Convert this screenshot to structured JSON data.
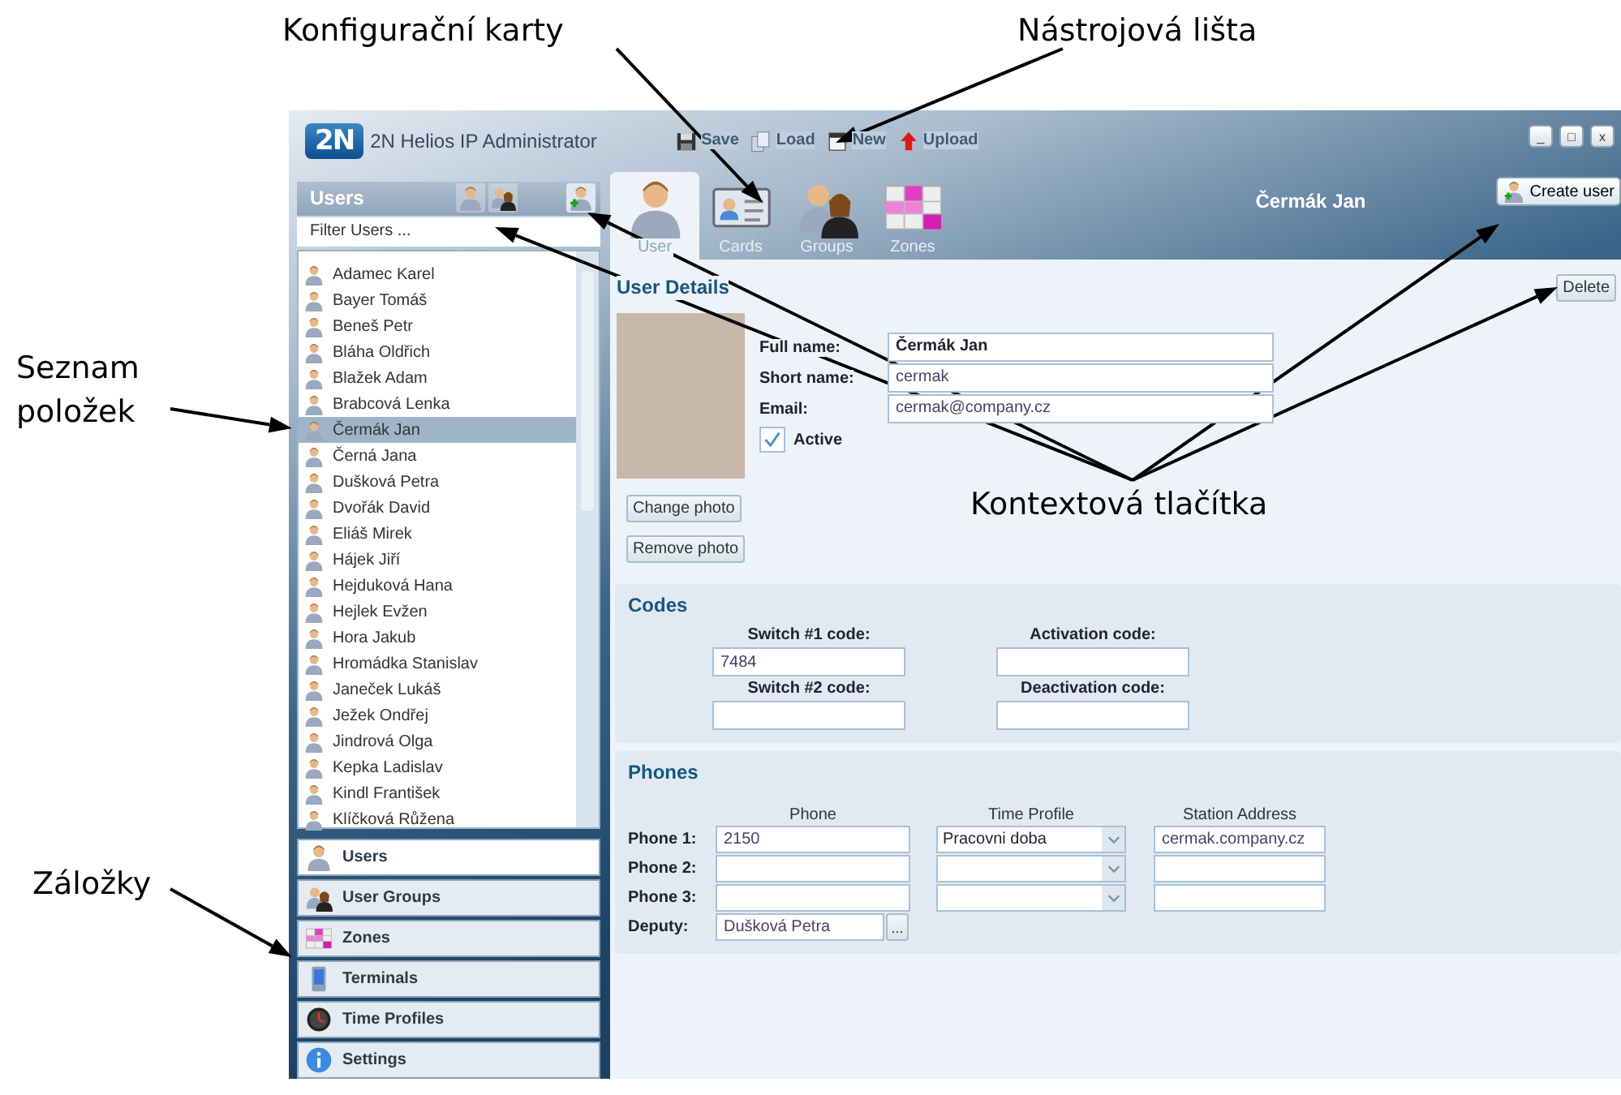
{
  "annotations": [
    {
      "text": "Konfigurační karty",
      "kind": "top"
    },
    {
      "text": "Nástrojová lišta",
      "kind": "top"
    },
    {
      "text": "Seznam položek",
      "kind": "side"
    },
    {
      "text": "Kontextová tlačítka",
      "kind": "middle"
    },
    {
      "text": "Záložky",
      "kind": "side"
    }
  ],
  "window": {
    "logo": "2N",
    "title": "2N Helios IP Administrator",
    "toolbar": [
      {
        "label": "Save",
        "kind": "save"
      },
      {
        "label": "Load",
        "kind": "load"
      },
      {
        "label": "New",
        "kind": "new"
      },
      {
        "label": "Upload",
        "kind": "upload"
      }
    ],
    "controls": [
      "_",
      "□",
      "x"
    ]
  },
  "sidebar": {
    "title": "Users",
    "filter": {
      "placeholder": "Filter Users ..."
    },
    "items": [
      {
        "label": "Adamec Karel",
        "selected": false
      },
      {
        "label": "Bayer Tomáš",
        "selected": false
      },
      {
        "label": "Beneš Petr",
        "selected": false
      },
      {
        "label": "Bláha Oldřich",
        "selected": false
      },
      {
        "label": "Blažek Adam",
        "selected": false
      },
      {
        "label": "Brabcová Lenka",
        "selected": false
      },
      {
        "label": "Čermák Jan",
        "selected": true
      },
      {
        "label": "Černá Jana",
        "selected": false
      },
      {
        "label": "Dušková Petra",
        "selected": false
      },
      {
        "label": "Dvořák David",
        "selected": false
      },
      {
        "label": "Eliáš Mirek",
        "selected": false
      },
      {
        "label": "Hájek Jiří",
        "selected": false
      },
      {
        "label": "Hejduková Hana",
        "selected": false
      },
      {
        "label": "Hejlek Evžen",
        "selected": false
      },
      {
        "label": "Hora Jakub",
        "selected": false
      },
      {
        "label": "Hromádka Stanislav",
        "selected": false
      },
      {
        "label": "Janeček Lukáš",
        "selected": false
      },
      {
        "label": "Ježek Ondřej",
        "selected": false
      },
      {
        "label": "Jindrová Olga",
        "selected": false
      },
      {
        "label": "Kepka Ladislav",
        "selected": false
      },
      {
        "label": "Kindl František",
        "selected": false
      },
      {
        "label": "Klíčková Růžena",
        "selected": false
      }
    ],
    "nav": [
      {
        "label": "Users",
        "kind": "user",
        "selected": true
      },
      {
        "label": "User Groups",
        "kind": "group",
        "selected": false
      },
      {
        "label": "Zones",
        "kind": "zones",
        "selected": false
      },
      {
        "label": "Terminals",
        "kind": "terminal",
        "selected": false
      },
      {
        "label": "Time Profiles",
        "kind": "clock",
        "selected": false
      },
      {
        "label": "Settings",
        "kind": "info",
        "selected": false
      }
    ]
  },
  "config_tabs": [
    {
      "label": "User",
      "kind": "user",
      "selected": true
    },
    {
      "label": "Cards",
      "kind": "card",
      "selected": false
    },
    {
      "label": "Groups",
      "kind": "group",
      "selected": false
    },
    {
      "label": "Zones",
      "kind": "zones",
      "selected": false
    }
  ],
  "header_name": "Čermák Jan",
  "create_button": "Create user",
  "user_details": {
    "title": "User Details",
    "delete_button": "Delete",
    "fields": [
      {
        "label": "Full name:",
        "value": "Čermák Jan",
        "bold": true
      },
      {
        "label": "Short name:",
        "value": "cermak",
        "bold": false
      },
      {
        "label": "Email:",
        "value": "cermak@company.cz",
        "bold": false
      }
    ],
    "active": {
      "label": "Active",
      "checked": true
    },
    "buttons": [
      "Change photo",
      "Remove photo"
    ]
  },
  "codes": {
    "title": "Codes",
    "fields": [
      {
        "label": "Switch #1 code:",
        "value": "7484"
      },
      {
        "label": "Activation code:"
      },
      {
        "label": "Switch #2 code:"
      },
      {
        "label": "Deactivation code:"
      }
    ]
  },
  "phones": {
    "title": "Phones",
    "columns": [
      "Phone",
      "Time Profile",
      "Station Address"
    ],
    "rows": [
      {
        "label": "Phone 1:",
        "phone": "2150",
        "time_profile": "Pracovni doba",
        "station_address": "cermak.company.cz"
      },
      {
        "label": "Phone 2:"
      },
      {
        "label": "Phone 3:"
      }
    ],
    "deputy": {
      "label": "Deputy:",
      "value": "Dušková Petra",
      "button": "..."
    }
  }
}
